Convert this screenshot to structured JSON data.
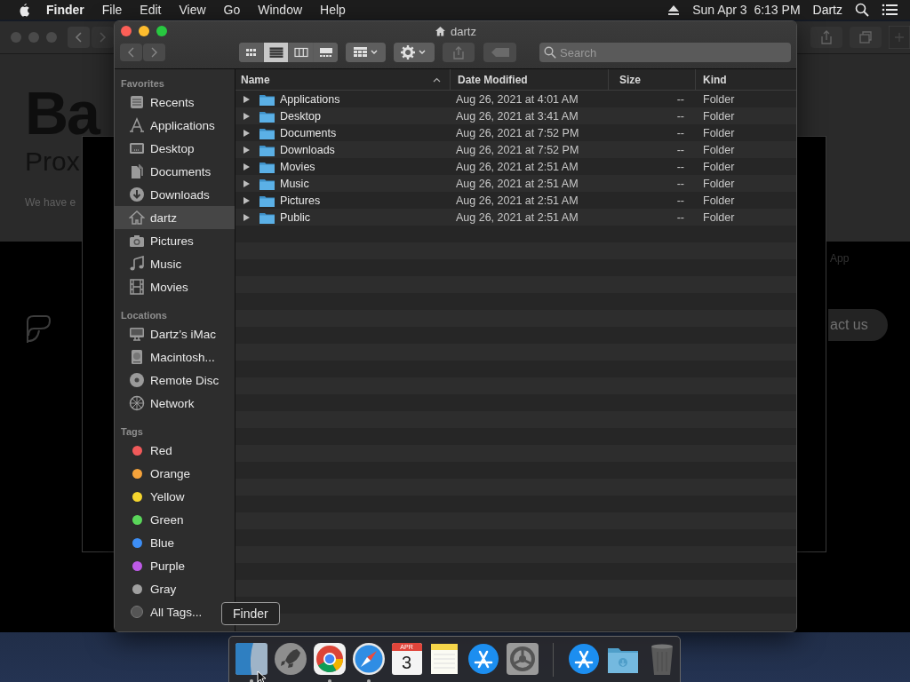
{
  "menubar": {
    "app_name": "Finder",
    "menus": [
      "File",
      "Edit",
      "View",
      "Go",
      "Window",
      "Help"
    ],
    "clock": "Sun Apr 3  6:13 PM",
    "user": "Dartz"
  },
  "background_window": {
    "heading": "Ba",
    "subheading": "Prox",
    "paragraph": "We have e",
    "link": "App",
    "button": "act us"
  },
  "finder": {
    "title": "dartz",
    "search": {
      "placeholder": "Search"
    },
    "view_modes": [
      {
        "kind": "icons",
        "selected": false
      },
      {
        "kind": "list",
        "selected": true
      },
      {
        "kind": "columns",
        "selected": false
      },
      {
        "kind": "gallery",
        "selected": false
      }
    ],
    "sidebar": [
      {
        "heading": "Favorites",
        "items": [
          {
            "label": "Recents",
            "kind": "recents",
            "selected": false
          },
          {
            "label": "Applications",
            "kind": "applications",
            "selected": false
          },
          {
            "label": "Desktop",
            "kind": "desktop",
            "selected": false
          },
          {
            "label": "Documents",
            "kind": "documents",
            "selected": false
          },
          {
            "label": "Downloads",
            "kind": "downloads",
            "selected": false
          },
          {
            "label": "dartz",
            "kind": "home",
            "selected": true
          },
          {
            "label": "Pictures",
            "kind": "pictures",
            "selected": false
          },
          {
            "label": "Music",
            "kind": "music",
            "selected": false
          },
          {
            "label": "Movies",
            "kind": "movies",
            "selected": false
          }
        ]
      },
      {
        "heading": "Locations",
        "items": [
          {
            "label": "Dartz’s iMac",
            "kind": "computer",
            "selected": false
          },
          {
            "label": "Macintosh...",
            "kind": "drive",
            "selected": false
          },
          {
            "label": "Remote Disc",
            "kind": "disc",
            "selected": false
          },
          {
            "label": "Network",
            "kind": "network",
            "selected": false
          }
        ]
      },
      {
        "heading": "Tags",
        "items": [
          {
            "label": "Red",
            "kind": "tag",
            "color": "#f05a5a",
            "selected": false
          },
          {
            "label": "Orange",
            "kind": "tag",
            "color": "#f5a33b",
            "selected": false
          },
          {
            "label": "Yellow",
            "kind": "tag",
            "color": "#f5d52e",
            "selected": false
          },
          {
            "label": "Green",
            "kind": "tag",
            "color": "#5ad65a",
            "selected": false
          },
          {
            "label": "Blue",
            "kind": "tag",
            "color": "#3d8ef5",
            "selected": false
          },
          {
            "label": "Purple",
            "kind": "tag",
            "color": "#bd5ae6",
            "selected": false
          },
          {
            "label": "Gray",
            "kind": "tag",
            "color": "#a0a0a0",
            "selected": false
          },
          {
            "label": "All Tags...",
            "kind": "alltags",
            "selected": false
          }
        ]
      }
    ],
    "columns": [
      {
        "label": "Name",
        "sorted": true
      },
      {
        "label": "Date Modified",
        "sorted": false
      },
      {
        "label": "Size",
        "sorted": false
      },
      {
        "label": "Kind",
        "sorted": false
      }
    ],
    "rows": [
      {
        "name": "Applications",
        "date": "Aug 26, 2021 at 4:01 AM",
        "size": "--",
        "kind": "Folder"
      },
      {
        "name": "Desktop",
        "date": "Aug 26, 2021 at 3:41 AM",
        "size": "--",
        "kind": "Folder"
      },
      {
        "name": "Documents",
        "date": "Aug 26, 2021 at 7:52 PM",
        "size": "--",
        "kind": "Folder"
      },
      {
        "name": "Downloads",
        "date": "Aug 26, 2021 at 7:52 PM",
        "size": "--",
        "kind": "Folder"
      },
      {
        "name": "Movies",
        "date": "Aug 26, 2021 at 2:51 AM",
        "size": "--",
        "kind": "Folder"
      },
      {
        "name": "Music",
        "date": "Aug 26, 2021 at 2:51 AM",
        "size": "--",
        "kind": "Folder"
      },
      {
        "name": "Pictures",
        "date": "Aug 26, 2021 at 2:51 AM",
        "size": "--",
        "kind": "Folder"
      },
      {
        "name": "Public",
        "date": "Aug 26, 2021 at 2:51 AM",
        "size": "--",
        "kind": "Folder"
      }
    ]
  },
  "tooltip": "Finder",
  "dock": {
    "items": [
      {
        "kind": "finder",
        "running": true
      },
      {
        "kind": "launchpad",
        "running": false
      },
      {
        "kind": "chrome",
        "running": true
      },
      {
        "kind": "safari",
        "running": true
      },
      {
        "kind": "calendar",
        "month": "APR",
        "day": "3",
        "running": false
      },
      {
        "kind": "notes",
        "running": false
      },
      {
        "kind": "appstore",
        "running": false
      },
      {
        "kind": "settings",
        "running": false
      },
      {
        "kind": "separator"
      },
      {
        "kind": "appstore",
        "running": false
      },
      {
        "kind": "folder",
        "running": false
      },
      {
        "kind": "trash",
        "running": false
      }
    ]
  }
}
